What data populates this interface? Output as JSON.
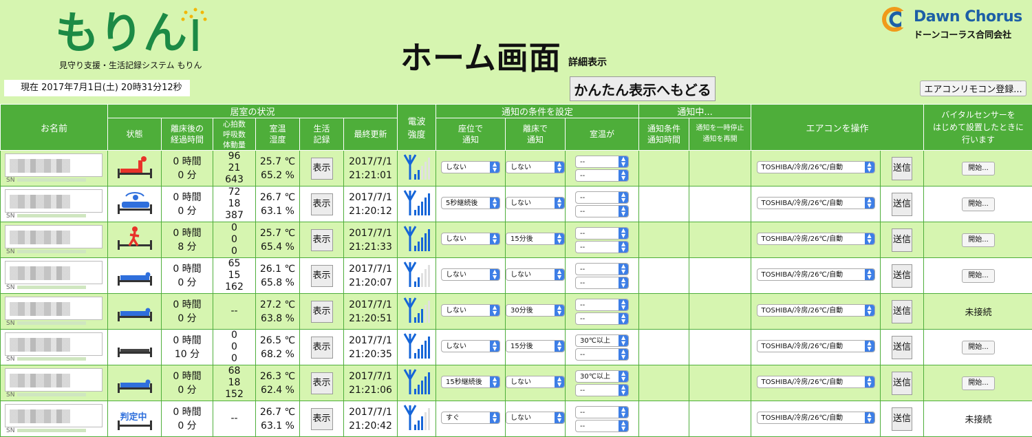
{
  "app": {
    "logo_text": "もりん",
    "logo_subtitle": "見守り支援・生活記録システム もりん",
    "brand_name": "Dawn Chorus",
    "brand_company": "ドーンコーラス合同会社"
  },
  "header": {
    "clock": "現在 2017年7月1日(土) 20時31分12秒",
    "title": "ホーム画面",
    "subtitle": "詳細表示",
    "simple_view_button": "かんたん表示へもどる",
    "remote_register_button": "エアコンリモコン登録..."
  },
  "columns": {
    "name": "お名前",
    "room_group": "居室の状況",
    "status": "状態",
    "away_time": [
      "離床後の",
      "経過時間"
    ],
    "vitals": [
      "心拍数",
      "呼吸数",
      "体動量"
    ],
    "temp_humidity": [
      "室温",
      "湿度"
    ],
    "record": [
      "生活",
      "記録"
    ],
    "last_update": "最終更新",
    "signal": [
      "電波",
      "強度"
    ],
    "notify_group": "通知の条件を設定",
    "notify_sitting": [
      "座位で",
      "通知"
    ],
    "notify_leaving": [
      "離床で",
      "通知"
    ],
    "notify_temp": "室温が",
    "notifying_group": "通知中...",
    "notify_cond_time": [
      "通知条件",
      "通知時間"
    ],
    "notify_resume": [
      "通知を一時停止",
      "通知を再開"
    ],
    "aircon": "エアコンを操作",
    "vital_sensor": [
      "バイタルセンサーを",
      "はじめて設置したときに",
      "行います"
    ]
  },
  "labels": {
    "sn": "SN",
    "show": "表示",
    "send": "送信"
  },
  "colors": {
    "background": "#d6f5b0",
    "header_green": "#4eae3a",
    "brand_blue": "#1d5fa6",
    "status_red": "#e8332a",
    "status_blue": "#2f6fdc",
    "signal_blue": "#1565d8"
  },
  "rows": [
    {
      "status_icon": "bed-sitting-red-icon",
      "hours": "0 時間",
      "minutes": "0 分",
      "vitals": [
        "96",
        "21",
        "643"
      ],
      "temp": "25.7 ℃",
      "humidity": "65.2 %",
      "date": "2017/7/1",
      "time": "21:21:01",
      "signal_bars": 2,
      "sitting": "しない",
      "leaving": "しない",
      "temp_cond": [
        "--",
        "--"
      ],
      "aircon": "TOSHIBA/冷房/26℃/自動",
      "sensor_action": "開始...",
      "sensor_is_button": true
    },
    {
      "status_icon": "bed-turning-blue-icon",
      "hours": "0 時間",
      "minutes": "0 分",
      "vitals": [
        "72",
        "18",
        "387"
      ],
      "temp": "26.7 ℃",
      "humidity": "63.1 %",
      "date": "2017/7/1",
      "time": "21:20:12",
      "signal_bars": 5,
      "sitting": "5秒継続後",
      "leaving": "しない",
      "temp_cond": [
        "--",
        "--"
      ],
      "aircon": "TOSHIBA/冷房/26℃/自動",
      "sensor_action": "開始...",
      "sensor_is_button": true
    },
    {
      "status_icon": "person-walking-red-icon",
      "hours": "0 時間",
      "minutes": "8 分",
      "vitals": [
        "0",
        "0",
        "0"
      ],
      "temp": "25.7 ℃",
      "humidity": "65.4 %",
      "date": "2017/7/1",
      "time": "21:21:33",
      "signal_bars": 5,
      "sitting": "しない",
      "leaving": "15分後",
      "temp_cond": [
        "--",
        "--"
      ],
      "aircon": "TOSHIBA/冷房/26℃/自動",
      "sensor_action": "開始...",
      "sensor_is_button": true
    },
    {
      "status_icon": "bed-lying-blue-icon",
      "hours": "0 時間",
      "minutes": "0 分",
      "vitals": [
        "65",
        "15",
        "162"
      ],
      "temp": "26.1 ℃",
      "humidity": "65.8 %",
      "date": "2017/7/1",
      "time": "21:20:07",
      "signal_bars": 2,
      "sitting": "しない",
      "leaving": "しない",
      "temp_cond": [
        "--",
        "--"
      ],
      "aircon": "TOSHIBA/冷房/26℃/自動",
      "sensor_action": "開始...",
      "sensor_is_button": true
    },
    {
      "status_icon": "bed-lying-blue-icon",
      "hours": "0 時間",
      "minutes": "0 分",
      "vitals": [
        "--"
      ],
      "temp": "27.2 ℃",
      "humidity": "63.8 %",
      "date": "2017/7/1",
      "time": "21:20:51",
      "signal_bars": 3,
      "sitting": "しない",
      "leaving": "30分後",
      "temp_cond": [
        "--",
        "--"
      ],
      "aircon": "TOSHIBA/冷房/26℃/自動",
      "sensor_action": "未接続",
      "sensor_is_button": false
    },
    {
      "status_icon": "bed-empty-icon",
      "hours": "0 時間",
      "minutes": "10 分",
      "vitals": [
        "0",
        "0",
        "0"
      ],
      "temp": "26.5 ℃",
      "humidity": "68.2 %",
      "date": "2017/7/1",
      "time": "21:20:35",
      "signal_bars": 5,
      "sitting": "しない",
      "leaving": "15分後",
      "temp_cond": [
        "30℃以上",
        "--"
      ],
      "aircon": "TOSHIBA/冷房/26℃/自動",
      "sensor_action": "開始...",
      "sensor_is_button": true
    },
    {
      "status_icon": "bed-lying-blue-icon",
      "hours": "0 時間",
      "minutes": "0 分",
      "vitals": [
        "68",
        "18",
        "152"
      ],
      "temp": "26.3 ℃",
      "humidity": "62.4 %",
      "date": "2017/7/1",
      "time": "21:21:06",
      "signal_bars": 5,
      "sitting": "15秒継続後",
      "leaving": "しない",
      "temp_cond": [
        "30℃以上",
        "--"
      ],
      "aircon": "TOSHIBA/冷房/26℃/自動",
      "sensor_action": "開始...",
      "sensor_is_button": true
    },
    {
      "status_icon": "judging-icon",
      "status_text": "判定中",
      "hours": "0 時間",
      "minutes": "0 分",
      "vitals": [
        "--"
      ],
      "temp": "26.7 ℃",
      "humidity": "63.1 %",
      "date": "2017/7/1",
      "time": "21:20:42",
      "signal_bars": 3,
      "sitting": "すぐ",
      "leaving": "しない",
      "temp_cond": [
        "--",
        "--"
      ],
      "aircon": "TOSHIBA/冷房/26℃/自動",
      "sensor_action": "未接続",
      "sensor_is_button": false
    }
  ]
}
